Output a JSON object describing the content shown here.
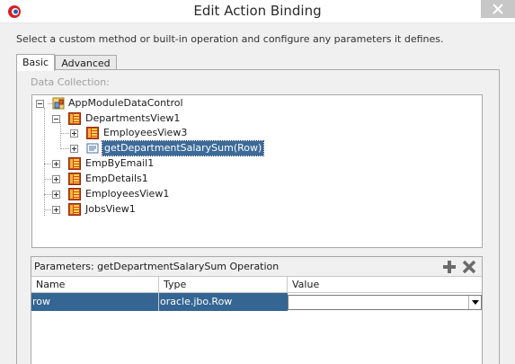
{
  "window": {
    "title": "Edit Action Binding"
  },
  "description": "Select a custom method or built-in operation and configure any parameters it defines.",
  "tabs": [
    {
      "label": "Basic",
      "active": true
    },
    {
      "label": "Advanced",
      "active": false
    }
  ],
  "data_collection": {
    "label": "Data Collection:",
    "tree": [
      {
        "label": "AppModuleDataControl",
        "icon": "data-control-icon",
        "expanded": true
      },
      {
        "label": "DepartmentsView1",
        "icon": "view-object-icon",
        "expanded": true
      },
      {
        "label": "EmployeesView3",
        "icon": "view-object-icon",
        "expanded": false
      },
      {
        "label": "getDepartmentSalarySum(Row)",
        "icon": "method-icon",
        "expanded": false,
        "selected": true
      },
      {
        "label": "EmpByEmail1",
        "icon": "view-object-icon",
        "expanded": false
      },
      {
        "label": "EmpDetails1",
        "icon": "view-object-icon",
        "expanded": false
      },
      {
        "label": "EmployeesView1",
        "icon": "view-object-icon",
        "expanded": false
      },
      {
        "label": "JobsView1",
        "icon": "view-object-icon",
        "expanded": false
      }
    ]
  },
  "parameters": {
    "title": "Parameters:  getDepartmentSalarySum Operation",
    "columns": [
      "Name",
      "Type",
      "Value"
    ],
    "rows": [
      {
        "name": "row",
        "type": "oracle.jbo.Row",
        "value": ""
      }
    ]
  },
  "colors": {
    "selection": "#3d6b99",
    "view_object_icon": "#d04a1a"
  }
}
